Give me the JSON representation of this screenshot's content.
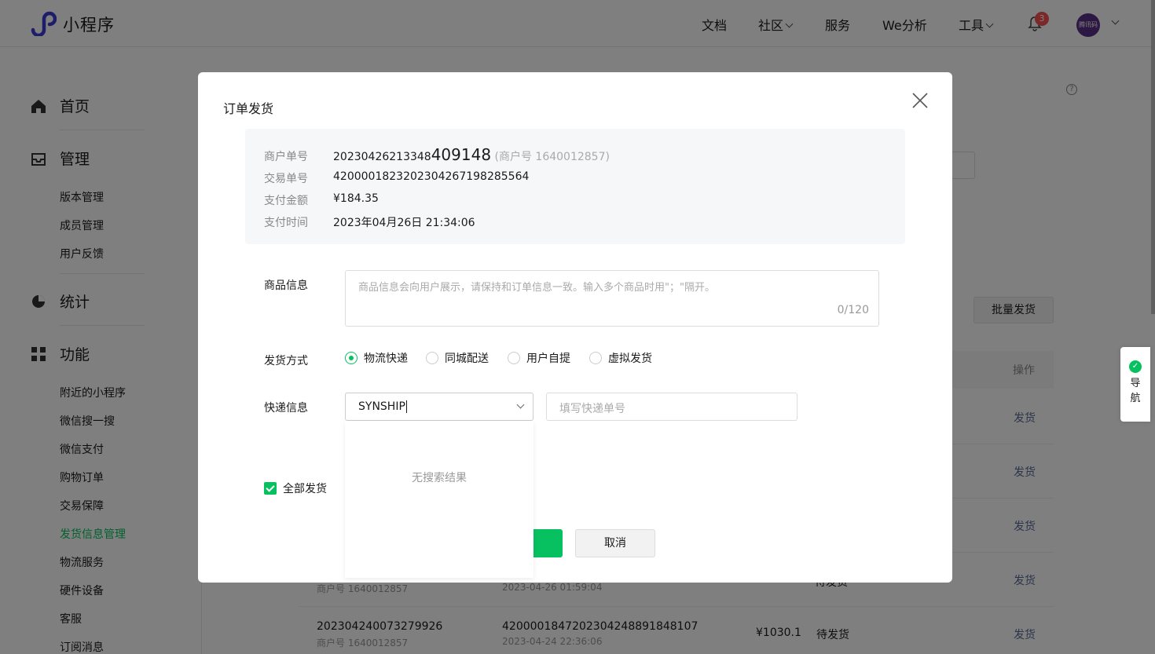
{
  "header": {
    "logo_text": "小程序",
    "nav": [
      {
        "label": "文档",
        "has_menu": false
      },
      {
        "label": "社区",
        "has_menu": true
      },
      {
        "label": "服务",
        "has_menu": false
      },
      {
        "label": "We分析",
        "has_menu": false
      },
      {
        "label": "工具",
        "has_menu": true
      }
    ],
    "notification_count": "3",
    "avatar_text": "腾讯码"
  },
  "sidebar": {
    "sections": [
      {
        "label": "首页",
        "icon": "home-icon"
      },
      {
        "label": "管理",
        "icon": "inbox-icon"
      },
      {
        "label": "统计",
        "icon": "pie-chart-icon"
      },
      {
        "label": "功能",
        "icon": "grid-icon"
      }
    ],
    "manage_items": [
      "版本管理",
      "成员管理",
      "用户反馈"
    ],
    "feature_items": [
      "附近的小程序",
      "微信搜一搜",
      "微信支付",
      "购物订单",
      "交易保障",
      "发货信息管理",
      "物流服务",
      "硬件设备",
      "客服",
      "订阅消息"
    ],
    "active_item": "发货信息管理"
  },
  "background": {
    "batch_button": "批量发货",
    "op_header": "操作",
    "ship_link": "发货",
    "rows": [
      {
        "sub_merchant": "商户号 1640012857",
        "sub_time": "2023-04-26 01:59:04",
        "status": "待发货"
      },
      {
        "order_id": "202304240073279926",
        "sub_merchant": "商户号 1640012857",
        "trade_id": "4200001847202304248891848107",
        "sub_time": "2023-04-24 22:36:06",
        "amount": "¥1030.1",
        "status": "待发货"
      }
    ]
  },
  "float_nav": {
    "label_1": "导",
    "label_2": "航"
  },
  "dialog": {
    "title": "订单发货",
    "info": {
      "merchant_order_label": "商户单号",
      "merchant_order_prefix": "20230426213348",
      "merchant_order_suffix": "409148",
      "merchant_no": "(商户号 1640012857)",
      "trade_no_label": "交易单号",
      "trade_no": "4200001823202304267198285564",
      "amount_label": "支付金额",
      "amount": "¥184.35",
      "time_label": "支付时间",
      "time": "2023年04月26日 21:34:06"
    },
    "goods_label": "商品信息",
    "goods_placeholder": "商品信息会向用户展示，请保持和订单信息一致。输入多个商品时用\"；\"隔开。",
    "goods_counter": "0/120",
    "ship_method_label": "发货方式",
    "ship_methods": [
      {
        "label": "物流快递",
        "selected": true
      },
      {
        "label": "同城配送",
        "selected": false
      },
      {
        "label": "用户自提",
        "selected": false
      },
      {
        "label": "虚拟发货",
        "selected": false
      }
    ],
    "express_label": "快递信息",
    "carrier_value": "SYNSHIP",
    "tracking_placeholder": "填写快递单号",
    "dropdown_empty": "无搜索结果",
    "ship_all_label": "全部发货",
    "ship_all_checked": true,
    "cancel_label": "取消",
    "accent_color": "#07c160"
  }
}
